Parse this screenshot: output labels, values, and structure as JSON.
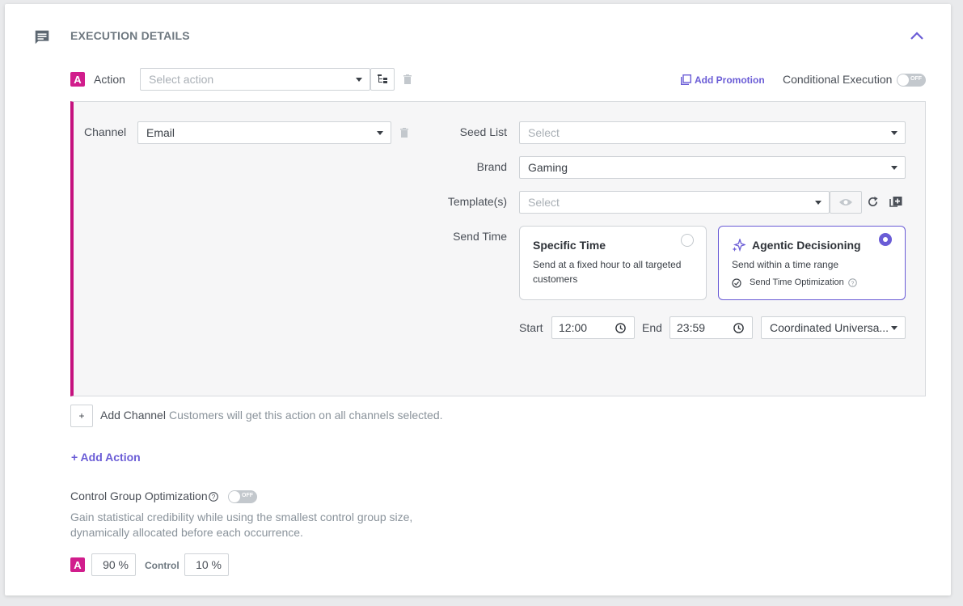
{
  "section": {
    "title": "EXECUTION DETAILS"
  },
  "action": {
    "badge": "A",
    "label": "Action",
    "select_placeholder": "Select action",
    "add_promotion": "Add Promotion",
    "conditional_execution": "Conditional Execution",
    "conditional_toggle": "OFF"
  },
  "channel": {
    "label": "Channel",
    "value": "Email",
    "seed_list_label": "Seed List",
    "seed_list_placeholder": "Select",
    "brand_label": "Brand",
    "brand_value": "Gaming",
    "templates_label": "Template(s)",
    "templates_placeholder": "Select",
    "send_time_label": "Send Time",
    "specific_time": {
      "title": "Specific Time",
      "desc": "Send at a fixed hour to all targeted customers",
      "selected": false
    },
    "agentic": {
      "title": "Agentic Decisioning",
      "desc": "Send within a time range",
      "feature": "Send Time Optimization",
      "selected": true
    },
    "start_label": "Start",
    "start_value": "12:00",
    "end_label": "End",
    "end_value": "23:59",
    "timezone": "Coordinated Universa..."
  },
  "add_channel": {
    "plus": "+",
    "label": "Add Channel",
    "hint": "Customers will get this action on all channels selected."
  },
  "add_action": "+ Add Action",
  "cgo": {
    "label": "Control Group Optimization",
    "toggle": "OFF",
    "desc_line1": "Gain statistical credibility while using the smallest control group size,",
    "desc_line2": "dynamically allocated before each occurrence.",
    "badge": "A",
    "a_value": "90 %",
    "control_label": "Control",
    "control_value": "10 %"
  },
  "colors": {
    "accent": "#6a5cd6",
    "brand": "#d11d8c",
    "channel_bar": "#c5127f"
  },
  "icons": [
    "message-icon",
    "chevron-up-icon",
    "tree-icon",
    "trash-icon",
    "copy-icon",
    "eye-icon",
    "refresh-icon",
    "add-copy-icon",
    "sparkle-icon",
    "check-circle-icon",
    "help-icon",
    "clock-icon"
  ]
}
